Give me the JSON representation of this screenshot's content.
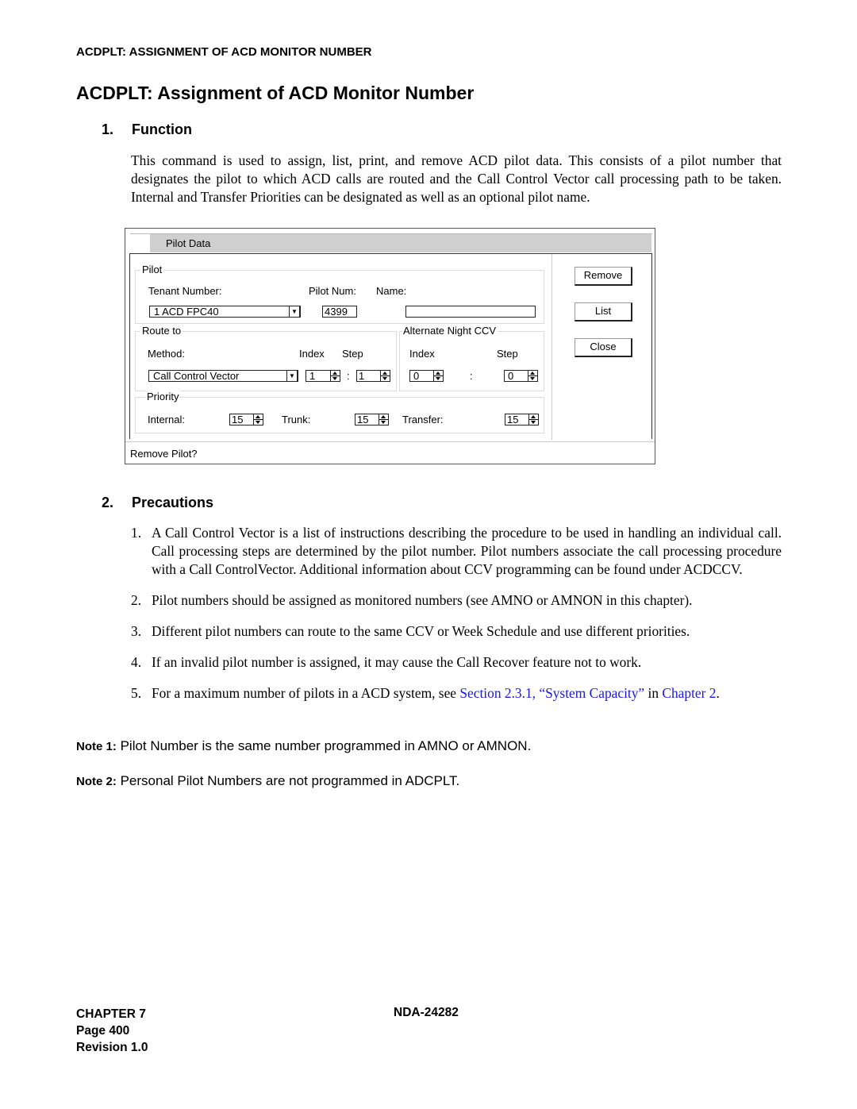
{
  "running_head": "ACDPLT: ASSIGNMENT OF ACD MONITOR NUMBER",
  "page_title": "ACDPLT: Assignment of ACD Monitor Number",
  "sections": {
    "function": {
      "number": "1.",
      "title": "Function",
      "text": "This command is used to assign, list, print, and remove ACD pilot data. This consists of a pilot number that designates the pilot to which ACD calls are routed and the Call Control Vector call processing path to be taken. Internal and Transfer Priorities can be designated as well as an optional pilot name."
    },
    "precautions": {
      "number": "2.",
      "title": "Precautions",
      "items": [
        {
          "num": "1.",
          "text": "A Call Control Vector is a list of instructions describing the procedure to be used in handling an individual call. Call processing steps are determined by the pilot number. Pilot numbers associate the call processing procedure with a Call ControlVector. Additional information about CCV programming can be found under ACDCCV."
        },
        {
          "num": "2.",
          "text": "Pilot numbers should be assigned as monitored numbers (see AMNO or AMNON in this chapter)."
        },
        {
          "num": "3.",
          "text": "Different pilot numbers can route to the same CCV or Week Schedule and use different priorities."
        },
        {
          "num": "4.",
          "text": "If an invalid pilot number is assigned, it may cause the Call Recover feature not to work."
        },
        {
          "num": "5.",
          "text_before": "For a maximum number of pilots in a ACD system, see ",
          "link1": "Section 2.3.1, “System Capacity”",
          "text_mid": " in ",
          "link2": "Chapter 2",
          "text_after": "."
        }
      ]
    }
  },
  "dialog": {
    "tab_label": "Pilot Data",
    "pilot_group": {
      "label": "Pilot",
      "tenant_label": "Tenant Number:",
      "tenant_value": "1 ACD FPC40",
      "pilot_num_label": "Pilot Num:",
      "pilot_num_value": "4399",
      "name_label": "Name:",
      "name_value": ""
    },
    "route_group": {
      "label": "Route to",
      "method_label": "Method:",
      "method_value": "Call Control Vector",
      "index_label": "Index",
      "step_label": "Step",
      "index_value": "1",
      "separator": ":",
      "step_value": "1"
    },
    "alt_night_group": {
      "label": "Alternate Night CCV",
      "index_label": "Index",
      "step_label": "Step",
      "index_value": "0",
      "separator": ":",
      "step_value": "0"
    },
    "priority_group": {
      "label": "Priority",
      "internal_label": "Internal:",
      "internal_value": "15",
      "trunk_label": "Trunk:",
      "trunk_value": "15",
      "transfer_label": "Transfer:",
      "transfer_value": "15"
    },
    "buttons": {
      "remove": "Remove",
      "list": "List",
      "close": "Close"
    },
    "status": "Remove Pilot?"
  },
  "notes": [
    {
      "label": "Note 1:",
      "text": "Pilot Number is the same number programmed in AMNO or AMNON."
    },
    {
      "label": "Note 2:",
      "text": "Personal Pilot Numbers are not programmed in ADCPLT."
    }
  ],
  "footer": {
    "chapter": "CHAPTER 7",
    "page": "Page 400",
    "revision": "Revision 1.0",
    "doc_number": "NDA-24282"
  }
}
